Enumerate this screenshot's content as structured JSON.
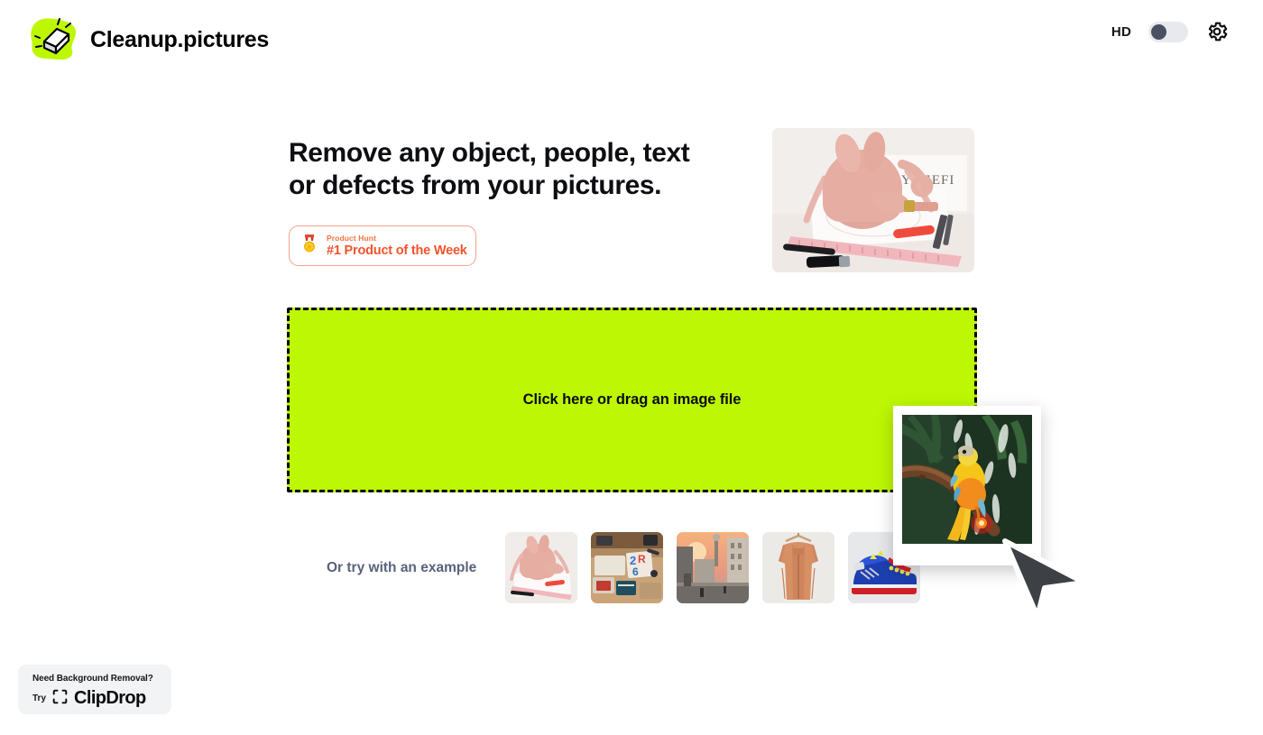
{
  "header": {
    "brand_name": "Cleanup.pictures",
    "logo_icon": "eraser-logo-icon",
    "hd_label": "HD",
    "hd_toggle_state": "off",
    "settings_icon": "gear-icon"
  },
  "hero": {
    "headline": "Remove any object, people, text\nor defects from your pictures.",
    "product_hunt": {
      "icon": "medal-icon",
      "top_label": "Product Hunt",
      "main_label": "#1 Product of the Week"
    },
    "photo_alt": "pink leather bag on workbench"
  },
  "dropzone": {
    "label": "Click here or drag an image file",
    "background_color": "#bdf703",
    "border_style": "dashed black"
  },
  "examples": {
    "label": "Or try with an example",
    "thumbnails": [
      {
        "name": "pink-bag",
        "alt": "pink leather bag"
      },
      {
        "name": "desk-workspace",
        "alt": "desk with design tools"
      },
      {
        "name": "city-street",
        "alt": "city street at sunset"
      },
      {
        "name": "orange-jacket",
        "alt": "orange jacket on hanger"
      },
      {
        "name": "blue-sneaker",
        "alt": "blue and red sneaker"
      }
    ]
  },
  "clipdrop": {
    "title": "Need Background Removal?",
    "try_label": "Try",
    "icon": "crop-brackets-icon",
    "product_name": "ClipDrop"
  },
  "drag_overlay": {
    "alt": "yellow parrot on a branch",
    "cursor": "arrow-cursor"
  },
  "colors": {
    "accent_green": "#bdf703",
    "product_hunt_orange": "#f5522a",
    "slate_text": "#59627a",
    "toggle_knob": "#4a5163"
  }
}
